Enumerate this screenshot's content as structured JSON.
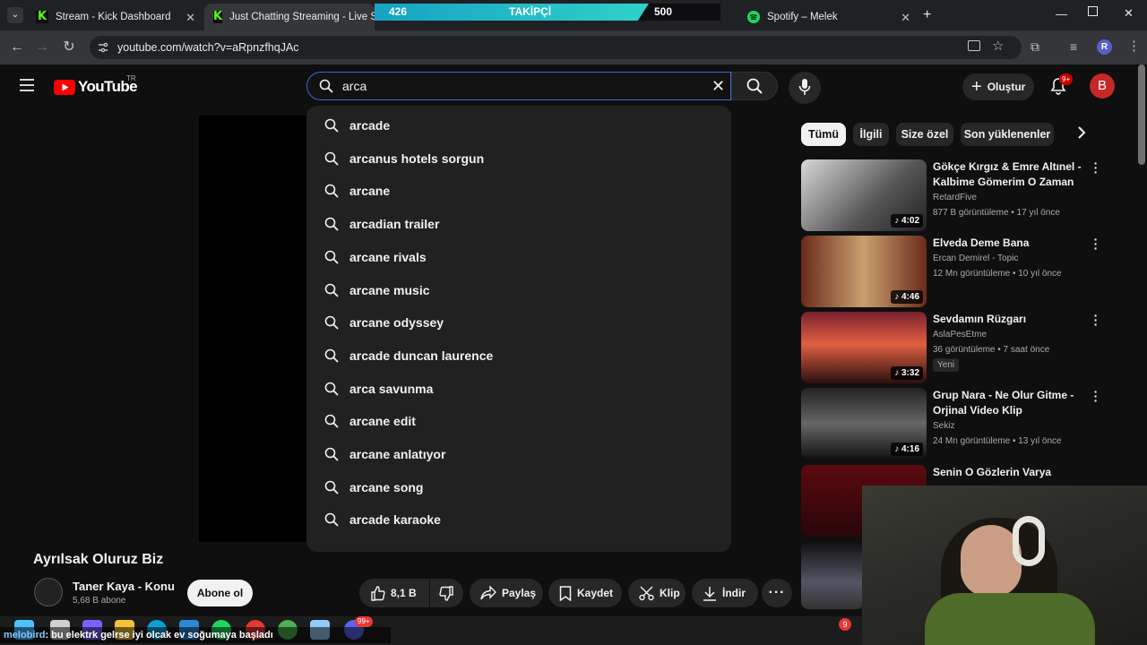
{
  "browser": {
    "tabs": [
      {
        "title": "Stream - Kick Dashboard"
      },
      {
        "title": "Just Chatting Streaming - Live S"
      },
      {
        "title": "Spotify – Melek"
      }
    ],
    "url": "youtube.com/watch?v=aRpnzfhqJAc",
    "profile_letter": "R"
  },
  "overlay": {
    "left_count": "426",
    "label": "TAKİPÇİ",
    "right_count": "500",
    "progress": 0.852
  },
  "youtube": {
    "logo_text": "YouTube",
    "region": "TR",
    "search_value": "arca",
    "create_label": "Oluştur",
    "notif_badge": "9+",
    "avatar_letter": "B",
    "suggestions": [
      "arcade",
      "arcanus hotels sorgun",
      "arcane",
      "arcadian trailer",
      "arcane rivals",
      "arcane music",
      "arcane odyssey",
      "arcade duncan laurence",
      "arca savunma",
      "arcane edit",
      "arcane anlatıyor",
      "arcane song",
      "arcade karaoke"
    ],
    "chips": [
      "Tümü",
      "İlgili",
      "Size özel",
      "Son yüklenenler"
    ],
    "recommendations": [
      {
        "title": "Gökçe Kırgız & Emre Altınel - Kalbime Gömerim O Zaman",
        "channel": "RetardFive",
        "meta": "877 B görüntüleme • 17 yıl önce",
        "duration": "4:02"
      },
      {
        "title": "Elveda Deme Bana",
        "channel": "Ercan Demirel - Topic",
        "meta": "12 Mn görüntüleme • 10 yıl önce",
        "duration": "4:46"
      },
      {
        "title": "Sevdamın Rüzgarı",
        "channel": "AslaPesEtme",
        "meta": "36 görüntüleme • 7 saat önce",
        "duration": "3:32",
        "badge": "Yeni"
      },
      {
        "title": "Grup Nara - Ne Olur Gitme - Orjinal Video Klip",
        "channel": "Sekiz",
        "meta": "24 Mn görüntüleme • 13 yıl önce",
        "duration": "4:16"
      },
      {
        "title": "Senin O Gözlerin Varya",
        "channel": "",
        "meta": "",
        "duration": ""
      }
    ],
    "video": {
      "title": "Ayrılsak Oluruz Biz",
      "channel": "Taner Kaya - Konu",
      "subscribers": "5,68 B abone",
      "subscribe_label": "Abone ol",
      "likes": "8,1 B",
      "share_label": "Paylaş",
      "save_label": "Kaydet",
      "clip_label": "Klip",
      "download_label": "İndir"
    }
  },
  "chat": {
    "user": "melobird",
    "message": ": bu elektrk gelrse iyi olcak ev soğumaya başladı"
  },
  "taskbar": {
    "notif_count": "9",
    "discord_badge": "99+"
  }
}
